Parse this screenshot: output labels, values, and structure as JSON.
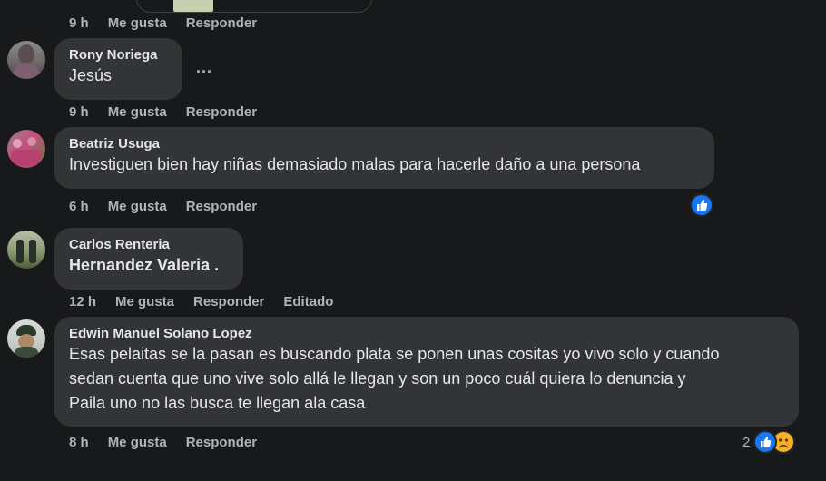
{
  "thread": {
    "top_actions": {
      "time": "9 h",
      "like": "Me gusta",
      "reply": "Responder"
    },
    "comments": [
      {
        "author": "Rony Noriega",
        "lines": [
          "Jesús"
        ],
        "time": "9 h",
        "like": "Me gusta",
        "reply": "Responder",
        "more": "..."
      },
      {
        "author": "Beatriz Usuga",
        "lines": [
          "Investiguen bien hay niñas demasiado malas para hacerle daño a una persona"
        ],
        "time": "6 h",
        "like": "Me gusta",
        "reply": "Responder",
        "reactions": [
          "like-icon"
        ]
      },
      {
        "author": "Carlos Renteria",
        "lines": [
          "Hernandez Valeria ."
        ],
        "time": "12 h",
        "like": "Me gusta",
        "reply": "Responder",
        "edited": "Editado"
      },
      {
        "author": "Edwin Manuel Solano Lopez",
        "lines": [
          "Esas pelaitas se la pasan es buscando plata se ponen unas cositas yo vivo solo y cuando",
          "sedan cuenta que uno vive solo allá le llegan y son un poco cuál quiera lo denuncia y",
          "Paila uno no las busca te llegan ala casa"
        ],
        "time": "8 h",
        "like": "Me gusta",
        "reply": "Responder",
        "reaction_count": "2",
        "reactions": [
          "like-icon",
          "sad-face-icon"
        ]
      }
    ]
  },
  "colors": {
    "background": "#18191a",
    "bubble": "#333436",
    "text": "#e4e6eb",
    "meta": "#b0b3b8",
    "like_blue": "#1877f2",
    "sad_yellow": "#f7b125"
  }
}
